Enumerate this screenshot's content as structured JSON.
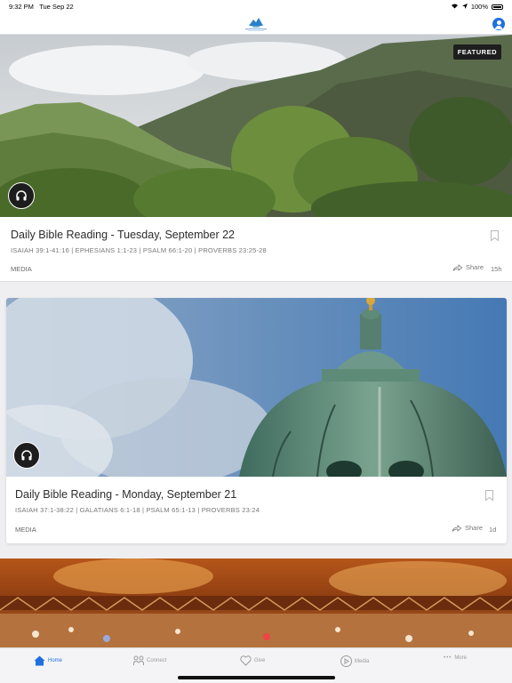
{
  "status_bar": {
    "time": "9:32 PM",
    "date": "Tue Sep 22",
    "battery": "100%"
  },
  "nav": {
    "logo": "church-logo",
    "profile_icon": "profile-icon"
  },
  "feed": [
    {
      "badge": "FEATURED",
      "title": "Daily Bible Reading - Tuesday, September 22",
      "subtitle": "ISAIAH 39:1-41:16 | EPHESIANS 1:1-23 | PSALM 66:1-20 | PROVERBS 23:25-28",
      "category": "MEDIA",
      "share_label": "Share",
      "age": "15h"
    },
    {
      "title": "Daily Bible Reading - Monday, September 21",
      "subtitle": "ISAIAH 37:1-38:22 | GALATIANS 6:1-18 | PSALM 65:1-13 | PROVERBS 23:24",
      "category": "MEDIA",
      "share_label": "Share",
      "age": "1d"
    }
  ],
  "tabs": [
    {
      "label": "Home",
      "icon": "home-icon",
      "active": true
    },
    {
      "label": "Connect",
      "icon": "connect-icon"
    },
    {
      "label": "Give",
      "icon": "heart-icon"
    },
    {
      "label": "Media",
      "icon": "play-icon"
    },
    {
      "label": "More",
      "icon": "more-icon"
    }
  ],
  "colors": {
    "accent": "#1f6fe0",
    "badge_bg": "#1e1e1e"
  }
}
